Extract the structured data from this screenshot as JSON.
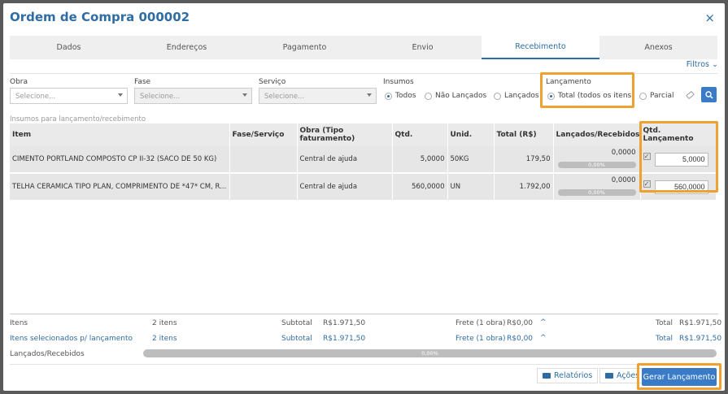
{
  "modal": {
    "title": "Ordem de Compra 000002",
    "close_icon": "×"
  },
  "tabs": [
    "Dados",
    "Endereços",
    "Pagamento",
    "Envio",
    "Recebimento",
    "Anexos"
  ],
  "filters": {
    "toggle_label": "Filtros",
    "obra": {
      "label": "Obra",
      "placeholder": "Selecione..."
    },
    "fase": {
      "label": "Fase",
      "placeholder": "Selecione..."
    },
    "servico": {
      "label": "Serviço",
      "placeholder": "Selecione..."
    },
    "insumos": {
      "label": "Insumos",
      "options": [
        "Todos",
        "Não Lançados",
        "Lançados"
      ],
      "selected": "Todos"
    },
    "lancamento": {
      "label": "Lançamento",
      "options": [
        "Total (todos os itens)",
        "Parcial"
      ],
      "selected": "Total (todos os itens)"
    }
  },
  "table": {
    "section_title": "Insumos para lançamento/recebimento",
    "headers": [
      "Item",
      "Fase/Serviço",
      "Obra (Tipo faturamento)",
      "Qtd.",
      "Unid.",
      "Total (R$)",
      "Lançados/Recebidos",
      "Qtd. Lançamento"
    ],
    "rows": [
      {
        "item": "CIMENTO PORTLAND COMPOSTO CP II-32 (SACO DE 50 KG)",
        "fase": "",
        "obra": "Central de ajuda",
        "qtd": "5,0000",
        "unid": "50KG",
        "total": "179,50",
        "lancados": "0,0000",
        "percent": "0,00%",
        "qtd_lanc": "5,0000"
      },
      {
        "item": "TELHA CERAMICA TIPO PLAN, COMPRIMENTO DE *47* CM, R...",
        "fase": "",
        "obra": "Central de ajuda",
        "qtd": "560,0000",
        "unid": "UN",
        "total": "1.792,00",
        "lancados": "0,0000",
        "percent": "0,00%",
        "qtd_lanc": "560,0000"
      }
    ]
  },
  "footer": {
    "itens": {
      "label": "Itens",
      "count": "2 itens",
      "subtotal_label": "Subtotal",
      "subtotal": "R$1.971,50",
      "frete_label": "Frete (1 obra)",
      "frete": "R$0,00",
      "total_label": "Total",
      "total": "R$1.971,50"
    },
    "selecionados": {
      "label": "Itens selecionados p/ lançamento",
      "count": "2 itens",
      "subtotal_label": "Subtotal",
      "subtotal": "R$1.971,50",
      "frete_label": "Frete (1 obra)",
      "frete": "R$0,00",
      "total_label": "Total",
      "total": "R$1.971,50"
    },
    "lancados_label": "Lançados/Recebidos",
    "progress_text": "0,00%",
    "progress": 0
  },
  "buttons": {
    "relatorios": "Relatórios",
    "acoes": "Ações",
    "gerar": "Gerar Lançamento"
  },
  "colors": {
    "accent": "#2e6da4",
    "primary_button": "#3a7bc8",
    "highlight": "#f0a030"
  }
}
